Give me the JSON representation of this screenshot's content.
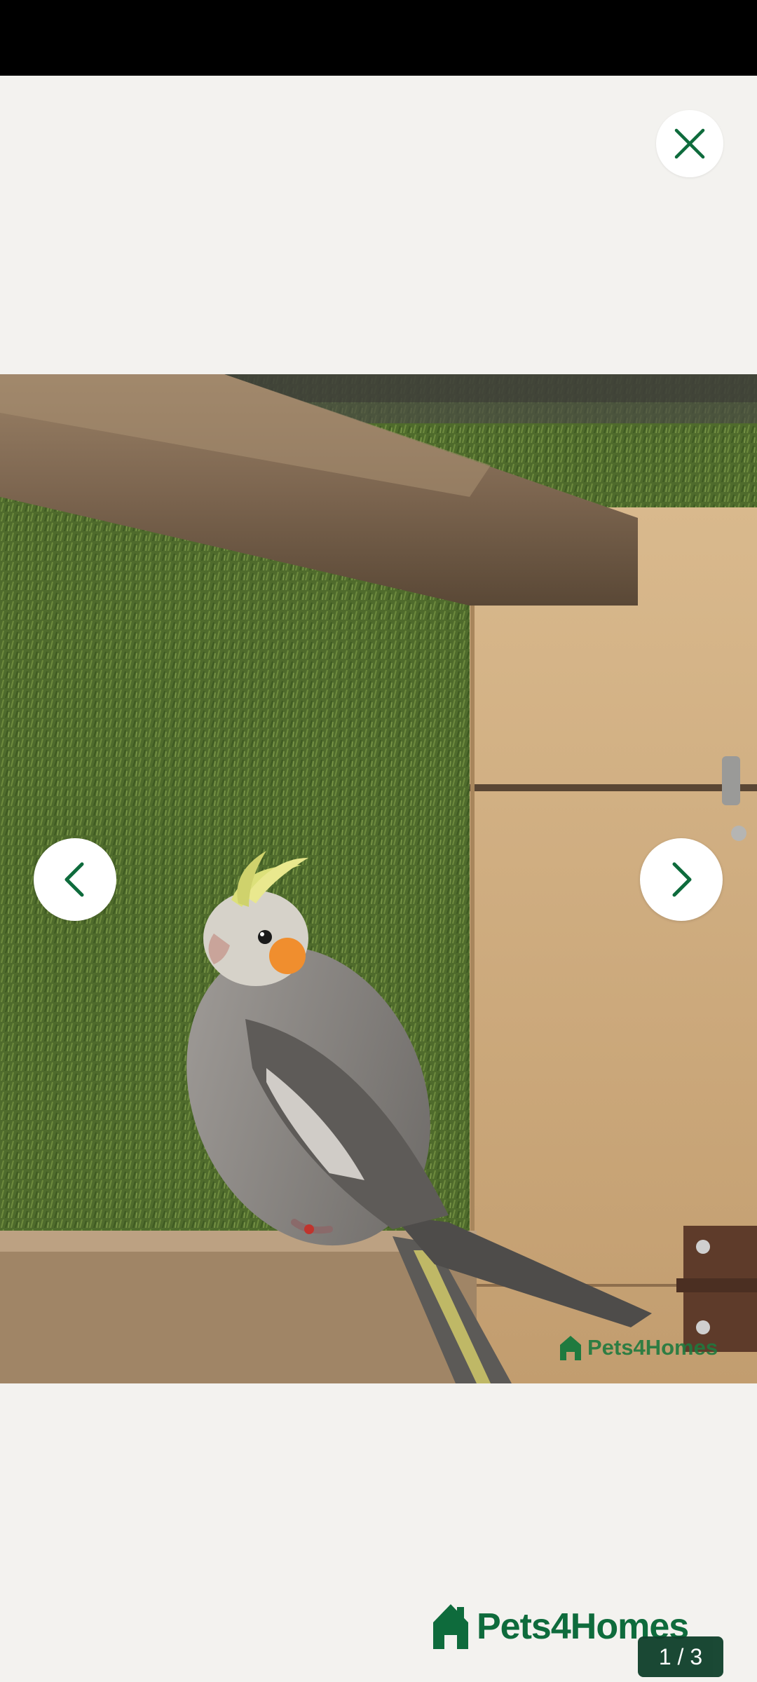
{
  "viewer": {
    "close_icon": "close-icon",
    "prev_icon": "chevron-left-icon",
    "next_icon": "chevron-right-icon",
    "counter_text": "1 / 3",
    "brand_name": "Pets4Homes",
    "watermark_text": "Pets4Homes",
    "brand_color": "#0e6b3c",
    "photo_subject": "cockatiel on wooden perch"
  }
}
